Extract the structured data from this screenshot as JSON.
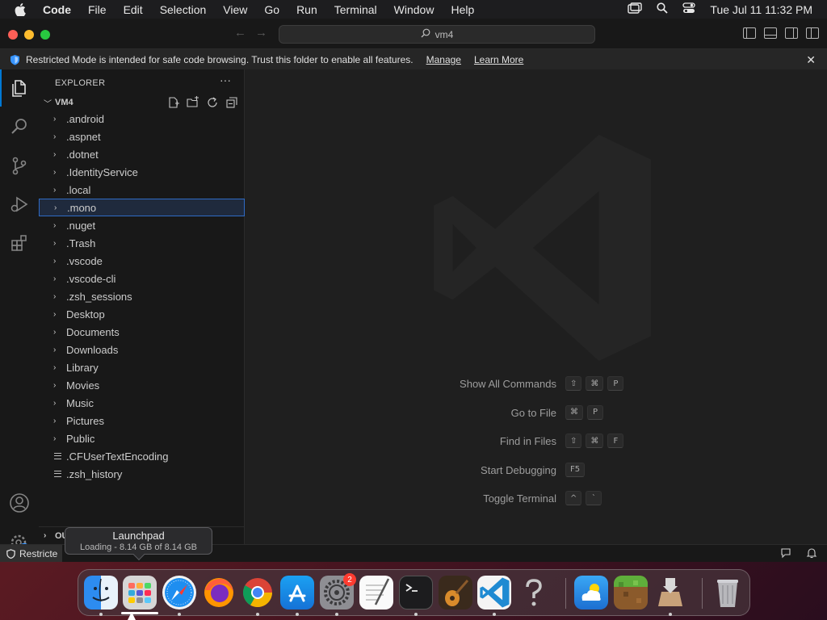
{
  "menubar": {
    "app": "Code",
    "items": [
      "File",
      "Edit",
      "Selection",
      "View",
      "Go",
      "Run",
      "Terminal",
      "Window",
      "Help"
    ],
    "clock": "Tue Jul 11  11:32 PM"
  },
  "titlebar": {
    "search": "vm4"
  },
  "banner": {
    "message": "Restricted Mode is intended for safe code browsing. Trust this folder to enable all features.",
    "manage": "Manage",
    "learn_more": "Learn More"
  },
  "sidebar": {
    "header": "EXPLORER",
    "more": "···",
    "folder": "VM4",
    "items": [
      {
        "name": ".android",
        "type": "folder"
      },
      {
        "name": ".aspnet",
        "type": "folder"
      },
      {
        "name": ".dotnet",
        "type": "folder"
      },
      {
        "name": ".IdentityService",
        "type": "folder"
      },
      {
        "name": ".local",
        "type": "folder"
      },
      {
        "name": ".mono",
        "type": "folder",
        "selected": true
      },
      {
        "name": ".nuget",
        "type": "folder"
      },
      {
        "name": ".Trash",
        "type": "folder"
      },
      {
        "name": ".vscode",
        "type": "folder"
      },
      {
        "name": ".vscode-cli",
        "type": "folder"
      },
      {
        "name": ".zsh_sessions",
        "type": "folder"
      },
      {
        "name": "Desktop",
        "type": "folder"
      },
      {
        "name": "Documents",
        "type": "folder"
      },
      {
        "name": "Downloads",
        "type": "folder"
      },
      {
        "name": "Library",
        "type": "folder"
      },
      {
        "name": "Movies",
        "type": "folder"
      },
      {
        "name": "Music",
        "type": "folder"
      },
      {
        "name": "Pictures",
        "type": "folder"
      },
      {
        "name": "Public",
        "type": "folder"
      },
      {
        "name": ".CFUserTextEncoding",
        "type": "file"
      },
      {
        "name": ".zsh_history",
        "type": "file"
      }
    ],
    "outline": "OUTLINE",
    "timeline": "TI"
  },
  "editor": {
    "shortcuts": [
      {
        "label": "Show All Commands",
        "keys": [
          "⇧",
          "⌘",
          "P"
        ]
      },
      {
        "label": "Go to File",
        "keys": [
          "⌘",
          "P"
        ]
      },
      {
        "label": "Find in Files",
        "keys": [
          "⇧",
          "⌘",
          "F"
        ]
      },
      {
        "label": "Start Debugging",
        "keys": [
          "F5"
        ]
      },
      {
        "label": "Toggle Terminal",
        "keys": [
          "^",
          "`"
        ]
      }
    ]
  },
  "statusbar": {
    "restricted": "Restricte"
  },
  "tooltip": {
    "title": "Launchpad",
    "subtitle": "Loading - 8.14 GB of 8.14 GB",
    "progress": 1.0
  },
  "dock": {
    "apps": [
      "finder-icon",
      "launchpad-icon",
      "safari-icon",
      "firefox-icon",
      "chrome-icon",
      "app-store-icon",
      "system-settings-icon",
      "textedit-icon",
      "terminal-icon",
      "garageband-icon",
      "vscode-icon",
      "help-icon",
      "weather-icon",
      "minecraft-icon",
      "installer-icon",
      "trash-icon"
    ],
    "settings_badge": "2"
  },
  "colors": {
    "accent": "#0078d4",
    "selection_border": "#2f6bc5",
    "editor_bg": "#1f1f1f",
    "sidebar_bg": "#181818"
  }
}
